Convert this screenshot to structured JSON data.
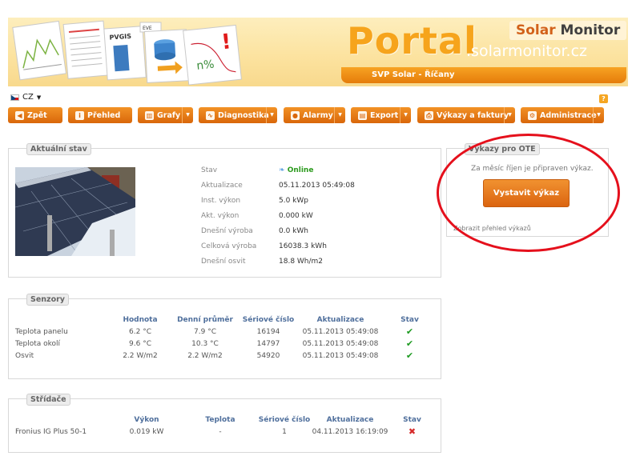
{
  "banner": {
    "portal": "Portal",
    "domain": ".solarmonitor.cz",
    "brand_a": "Solar",
    "brand_b": "Monitor",
    "site_name": "SVP Solar - Říčany",
    "art_labels": [
      "PVGIS",
      "EVE",
      "n%",
      "!"
    ]
  },
  "lang": {
    "code": "CZ"
  },
  "help": {
    "label": "?"
  },
  "nav": [
    {
      "label": "Zpět",
      "icon": "back-arrow-icon",
      "dropdown": false
    },
    {
      "label": "Přehled",
      "icon": "info-icon",
      "dropdown": false
    },
    {
      "label": "Grafy",
      "icon": "chart-icon",
      "dropdown": true
    },
    {
      "label": "Diagnostika",
      "icon": "stethoscope-icon",
      "dropdown": true
    },
    {
      "label": "Alarmy",
      "icon": "alarm-icon",
      "dropdown": true
    },
    {
      "label": "Export",
      "icon": "export-icon",
      "dropdown": true
    },
    {
      "label": "Výkazy a faktury",
      "icon": "printer-icon",
      "dropdown": true
    },
    {
      "label": "Administrace",
      "icon": "admin-icon",
      "dropdown": true
    }
  ],
  "current_state": {
    "title": "Aktuální stav",
    "rows": [
      {
        "label": "Stav",
        "value": "Online"
      },
      {
        "label": "Aktualizace",
        "value": "05.11.2013 05:49:08"
      },
      {
        "label": "Inst. výkon",
        "value": "5.0 kWp"
      },
      {
        "label": "Akt. výkon",
        "value": "0.000 kW"
      },
      {
        "label": "Dnešní výroba",
        "value": "0.0 kWh"
      },
      {
        "label": "Celková výroba",
        "value": "16038.3 kWh"
      },
      {
        "label": "Dnešní osvit",
        "value": "18.8 Wh/m2"
      }
    ]
  },
  "sensors": {
    "title": "Senzory",
    "headers": [
      "",
      "Hodnota",
      "Denní průměr",
      "Sériové číslo",
      "Aktualizace",
      "Stav"
    ],
    "rows": [
      [
        "Teplota panelu",
        "6.2 °C",
        "7.9 °C",
        "16194",
        "05.11.2013 05:49:08",
        "ok"
      ],
      [
        "Teplota okolí",
        "9.6 °C",
        "10.3 °C",
        "14797",
        "05.11.2013 05:49:08",
        "ok"
      ],
      [
        "Osvit",
        "2.2 W/m2",
        "2.2 W/m2",
        "54920",
        "05.11.2013 05:49:08",
        "ok"
      ]
    ]
  },
  "inverters": {
    "title": "Střídače",
    "headers": [
      "",
      "Výkon",
      "Teplota",
      "Sériové číslo",
      "Aktualizace",
      "Stav"
    ],
    "rows": [
      [
        "Fronius IG Plus 50-1",
        "0.019 kW",
        "-",
        "1",
        "04.11.2013 16:19:09",
        "error"
      ]
    ]
  },
  "ote": {
    "title": "Výkazy pro OTE",
    "text": "Za měsíc říjen je připraven výkaz.",
    "button": "Vystavit výkaz",
    "link": "Zobrazit přehled výkazů"
  },
  "colors": {
    "accent_orange": "#e57c0a",
    "header_text": "#4f6f9c",
    "ok": "#1d9a21",
    "error": "#d62a2a",
    "highlight_ring": "#e5101c"
  }
}
